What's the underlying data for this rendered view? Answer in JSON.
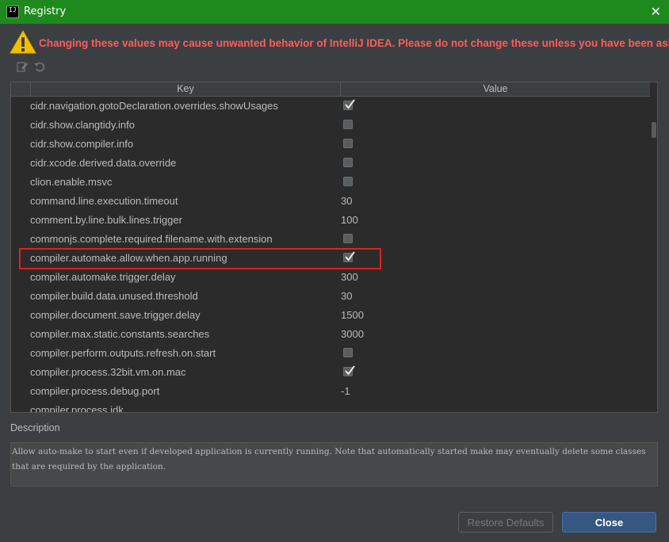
{
  "window": {
    "title": "Registry",
    "app_icon_text": "IJ"
  },
  "warning": {
    "text": "Changing these values may cause unwanted behavior of IntelliJ IDEA. Please do not change these unless you have been asked.",
    "color": "#ff5c5c"
  },
  "toolbar": {
    "edit_icon": "edit-icon",
    "revert_icon": "revert-icon"
  },
  "table": {
    "headers": {
      "key": "Key",
      "value": "Value"
    },
    "rows": [
      {
        "key": "cidr.navigation.gotoDeclaration.overrides.showUsages",
        "type": "checkbox",
        "checked": true
      },
      {
        "key": "cidr.show.clangtidy.info",
        "type": "checkbox",
        "checked": false
      },
      {
        "key": "cidr.show.compiler.info",
        "type": "checkbox",
        "checked": false
      },
      {
        "key": "cidr.xcode.derived.data.override",
        "type": "checkbox",
        "checked": false
      },
      {
        "key": "clion.enable.msvc",
        "type": "checkbox",
        "checked": false
      },
      {
        "key": "command.line.execution.timeout",
        "type": "text",
        "value": "30"
      },
      {
        "key": "comment.by.line.bulk.lines.trigger",
        "type": "text",
        "value": "100"
      },
      {
        "key": "commonjs.complete.required.filename.with.extension",
        "type": "checkbox",
        "checked": false
      },
      {
        "key": "compiler.automake.allow.when.app.running",
        "type": "checkbox",
        "checked": true,
        "highlighted": true
      },
      {
        "key": "compiler.automake.trigger.delay",
        "type": "text",
        "value": "300"
      },
      {
        "key": "compiler.build.data.unused.threshold",
        "type": "text",
        "value": "30"
      },
      {
        "key": "compiler.document.save.trigger.delay",
        "type": "text",
        "value": "1500"
      },
      {
        "key": "compiler.max.static.constants.searches",
        "type": "text",
        "value": "3000"
      },
      {
        "key": "compiler.perform.outputs.refresh.on.start",
        "type": "checkbox",
        "checked": false
      },
      {
        "key": "compiler.process.32bit.vm.on.mac",
        "type": "checkbox",
        "checked": true
      },
      {
        "key": "compiler.process.debug.port",
        "type": "text",
        "value": "-1"
      },
      {
        "key": "compiler.process.jdk",
        "type": "text",
        "value": ""
      }
    ]
  },
  "description": {
    "label": "Description",
    "text": "Allow auto-make to start even if developed application is currently running. Note that automatically started make may eventually delete some classes that are required by the application."
  },
  "buttons": {
    "restore": "Restore Defaults",
    "close": "Close"
  },
  "colors": {
    "titlebar": "#1e8a1e",
    "highlight": "#e02020",
    "background": "#3c3f41"
  }
}
